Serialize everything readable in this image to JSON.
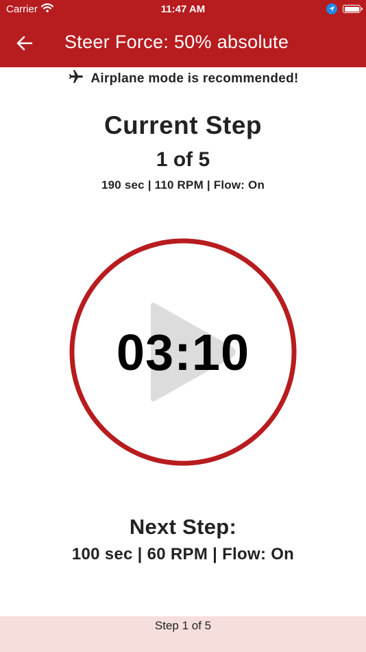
{
  "status_bar": {
    "carrier": "Carrier",
    "time": "11:47 AM"
  },
  "header": {
    "title": "Steer Force: 50% absolute",
    "back_icon": "arrow-left-icon",
    "background_color": "#b71c1f"
  },
  "notice": {
    "icon": "airplane-icon",
    "text": "Airplane mode is recommended!"
  },
  "current_step": {
    "title": "Current Step",
    "count": "1 of 5",
    "details": "190 sec | 110 RPM | Flow: On"
  },
  "timer": {
    "display": "03:10",
    "ring_color": "#b71c1f",
    "play_icon": "play-icon"
  },
  "next_step": {
    "title": "Next Step:",
    "details": "100 sec | 60 RPM | Flow: On"
  },
  "footer": {
    "text": "Step 1 of 5",
    "background_color": "#f6dedd"
  }
}
